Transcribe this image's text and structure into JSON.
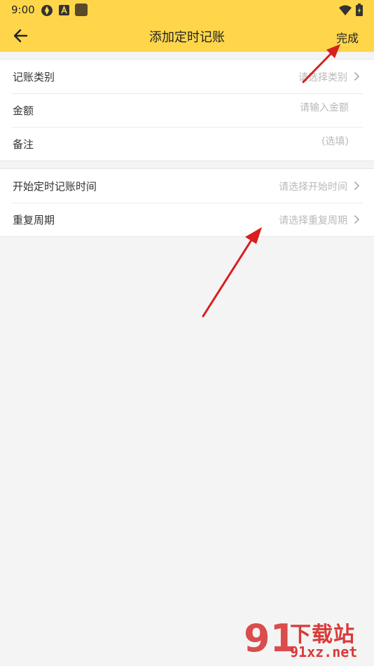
{
  "status_bar": {
    "time": "9:00"
  },
  "header": {
    "title": "添加定时记账",
    "done_label": "完成"
  },
  "form": {
    "group1": [
      {
        "label": "记账类别",
        "hint": "请选择类别"
      },
      {
        "label": "金额",
        "placeholder": "请输入金额"
      },
      {
        "label": "备注",
        "placeholder": "(选填)"
      }
    ],
    "group2": [
      {
        "label": "开始定时记账时间",
        "hint": "请选择开始时间"
      },
      {
        "label": "重复周期",
        "hint": "请选择重复周期"
      }
    ]
  },
  "watermark": {
    "logo": "91",
    "brand_top": "下载站",
    "brand_bottom": "91xz.net"
  },
  "colors": {
    "accent": "#ffd64a",
    "arrow": "#d81e1e",
    "hint": "#b9b9b9"
  }
}
